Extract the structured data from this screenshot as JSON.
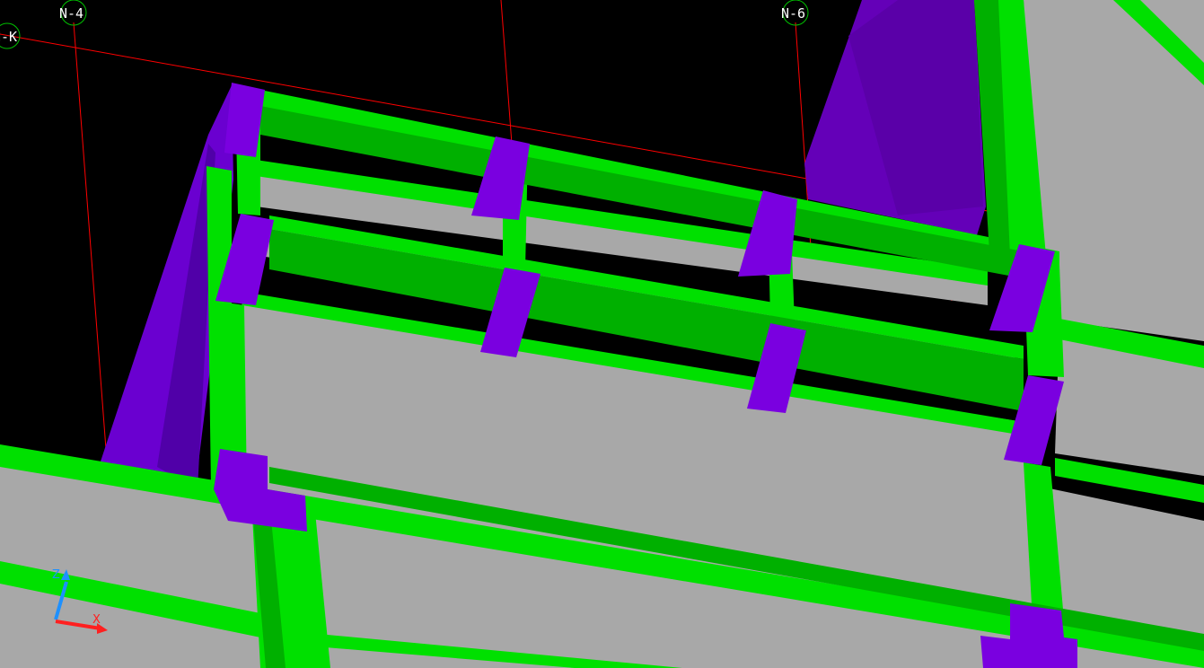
{
  "viewport": {
    "background": "#000000",
    "grid_labels": {
      "n4": "N-4",
      "n6": "N-6",
      "nk": "N-K"
    },
    "axes": {
      "z": "Z",
      "x": "X"
    },
    "colors": {
      "beam_light": "#00e000",
      "beam_dark": "#00b400",
      "connection": "#6a00d0",
      "connection_dark": "#5000a8",
      "slab": "#a8a8a8",
      "grid_line": "#ff0000",
      "grid_bubble": "#00c000",
      "axis_z": "#1e90ff",
      "axis_x": "#ff2020"
    }
  }
}
